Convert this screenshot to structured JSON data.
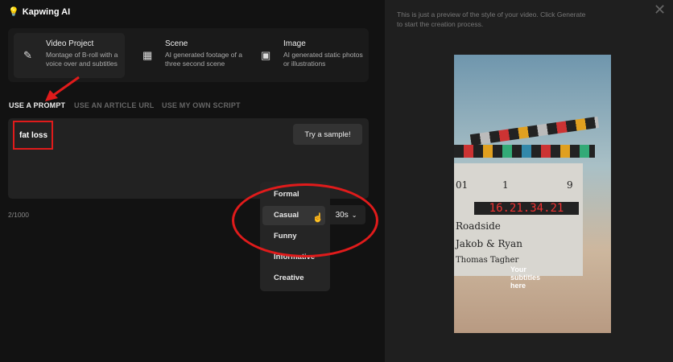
{
  "app": {
    "title": "Kapwing AI"
  },
  "types": [
    {
      "title": "Video Project",
      "desc": "Montage of B-roll with a voice over and subtitles",
      "icon": "magic-wand-icon"
    },
    {
      "title": "Scene",
      "desc": "AI generated footage of a three second scene",
      "icon": "film-icon"
    },
    {
      "title": "Image",
      "desc": "AI generated static photos or illustrations",
      "icon": "image-icon"
    }
  ],
  "tabs": [
    "USE A PROMPT",
    "USE AN ARTICLE URL",
    "USE MY OWN SCRIPT"
  ],
  "prompt": {
    "value": "fat loss",
    "sample": "Try a sample!",
    "count": "2/1000"
  },
  "duration": "30s",
  "tone_options": [
    "Formal",
    "Casual",
    "Funny",
    "Informative",
    "Creative"
  ],
  "preview": {
    "note": "This is just a preview of the style of your video. Click Generate to start the creation process.",
    "subtitles": "Your subtitles here",
    "board": {
      "led": "16.21.34.21",
      "roll": "01",
      "scene": "1",
      "take": "9",
      "line1": "Roadside",
      "line2": "Jakob & Ryan",
      "line3": "Thomas Tagher"
    }
  },
  "colors": {
    "annotation": "#e01b1b"
  }
}
